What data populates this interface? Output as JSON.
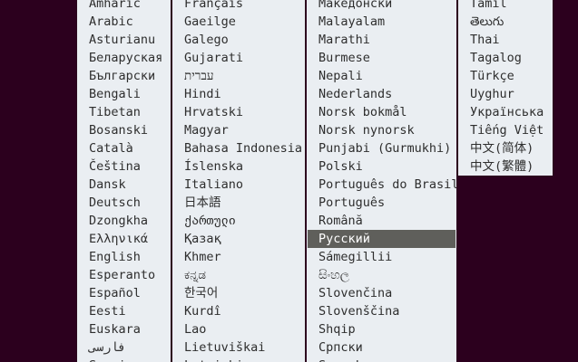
{
  "language_menu": {
    "columns": [
      {
        "items": [
          "Amharic",
          "Arabic",
          "Asturianu",
          "Беларуская",
          "Български",
          "Bengali",
          "Tibetan",
          "Bosanski",
          "Català",
          "Čeština",
          "Dansk",
          "Deutsch",
          "Dzongkha",
          "Ελληνικά",
          "English",
          "Esperanto",
          "Español",
          "Eesti",
          "Euskara",
          "فارسی",
          "Suomi"
        ]
      },
      {
        "items": [
          "Français",
          "Gaeilge",
          "Galego",
          "Gujarati",
          "עברית",
          "Hindi",
          "Hrvatski",
          "Magyar",
          "Bahasa Indonesia",
          "Íslenska",
          "Italiano",
          "日本語",
          "ქართული",
          "Қазақ",
          "Khmer",
          "ಕನ್ನಡ",
          "한국어",
          "Kurdî",
          "Lao",
          "Lietuviškai",
          "Latviski"
        ]
      },
      {
        "items": [
          "Македонски",
          "Malayalam",
          "Marathi",
          "Burmese",
          "Nepali",
          "Nederlands",
          "Norsk bokmål",
          "Norsk nynorsk",
          "Punjabi (Gurmukhi)",
          "Polski",
          "Português do Brasil",
          "Português",
          "Română",
          "Русский",
          "Sámegillii",
          "සිංහල",
          "Slovenčina",
          "Slovenščina",
          "Shqip",
          "Српски",
          "Svenska"
        ]
      },
      {
        "items": [
          "Tamil",
          "తెలుగు",
          "Thai",
          "Tagalog",
          "Türkçe",
          "Uyghur",
          "Українська",
          "Tiếng Việt",
          "中文(简体)",
          "中文(繁體)"
        ]
      }
    ],
    "selected": "Русский"
  }
}
